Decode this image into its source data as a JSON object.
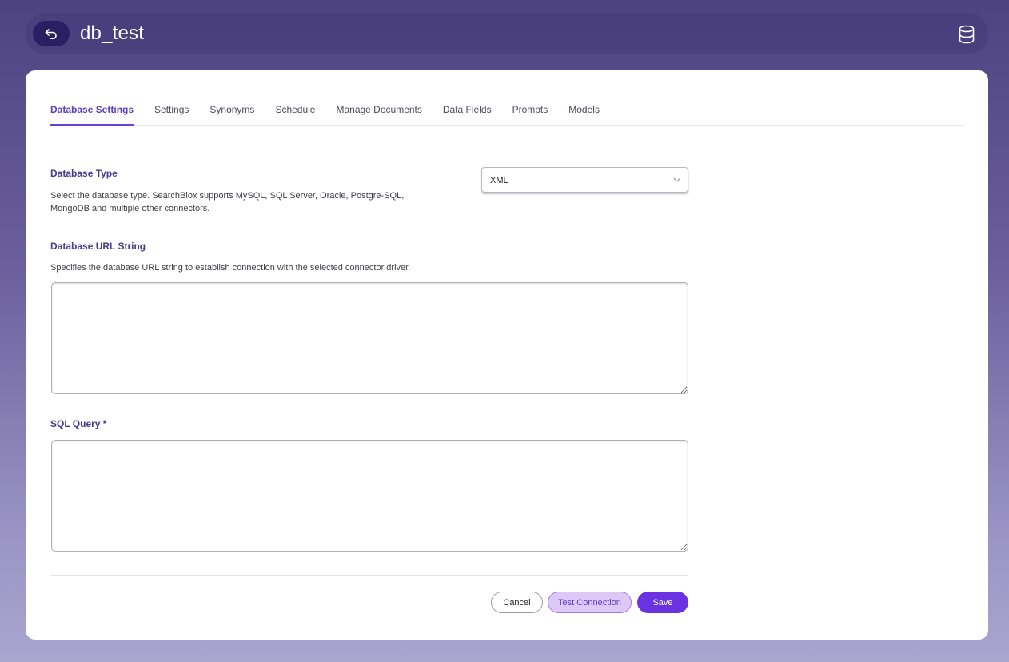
{
  "header": {
    "title": "db_test",
    "back_icon": "back-arrow-icon",
    "database_icon": "database-icon"
  },
  "tabs": [
    {
      "label": "Database Settings",
      "active": true
    },
    {
      "label": "Settings",
      "active": false
    },
    {
      "label": "Synonyms",
      "active": false
    },
    {
      "label": "Schedule",
      "active": false
    },
    {
      "label": "Manage Documents",
      "active": false
    },
    {
      "label": "Data Fields",
      "active": false
    },
    {
      "label": "Prompts",
      "active": false
    },
    {
      "label": "Models",
      "active": false
    }
  ],
  "database_type": {
    "label": "Database Type",
    "description_line1": "Select the database type. SearchBlox supports MySQL, SQL Server, Oracle, Postgre-SQL,",
    "description_line2": "MongoDB and multiple other connectors.",
    "selected_value": "XML"
  },
  "database_url": {
    "label": "Database URL String",
    "description": "Specifies the database URL string to establish connection with the selected connector driver.",
    "value": ""
  },
  "sql_query": {
    "label": "SQL Query *",
    "value": ""
  },
  "actions": {
    "cancel_label": "Cancel",
    "test_label": "Test Connection",
    "save_label": "Save"
  },
  "colors": {
    "accent": "#6a32e0",
    "label": "#4a3a8c",
    "active_tab": "#5b3fc0"
  }
}
